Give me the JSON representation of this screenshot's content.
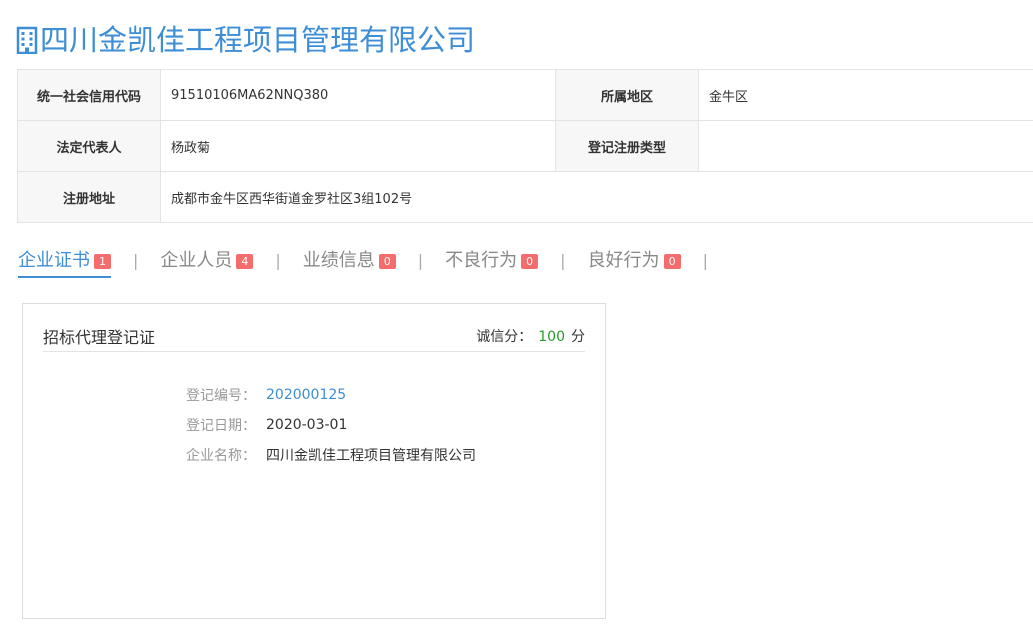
{
  "company": {
    "title": "四川金凯佳工程项目管理有限公司",
    "icon": "building-icon"
  },
  "info": {
    "credit_code_label": "统一社会信用代码",
    "credit_code": "91510106MA62NNQ380",
    "region_label": "所属地区",
    "region": "金牛区",
    "legal_rep_label": "法定代表人",
    "legal_rep": "杨政菊",
    "reg_type_label": "登记注册类型",
    "reg_type": "",
    "address_label": "注册地址",
    "address": "成都市金牛区西华街道金罗社区3组102号"
  },
  "tabs": [
    {
      "label": "企业证书",
      "count": "1",
      "active": true
    },
    {
      "label": "企业人员",
      "count": "4",
      "active": false
    },
    {
      "label": "业绩信息",
      "count": "0",
      "active": false
    },
    {
      "label": "不良行为",
      "count": "0",
      "active": false
    },
    {
      "label": "良好行为",
      "count": "0",
      "active": false
    }
  ],
  "separator": "|",
  "certificate": {
    "title": "招标代理登记证",
    "score_label": "诚信分：",
    "score": "100",
    "score_unit": "分",
    "fields": {
      "number_label": "登记编号：",
      "number": "202000125",
      "date_label": "登记日期：",
      "date": "2020-03-01",
      "name_label": "企业名称：",
      "name": "四川金凯佳工程项目管理有限公司"
    }
  },
  "colors": {
    "accent": "#3e8ed6",
    "badge": "#f56c6c",
    "score": "#2b9a2b"
  }
}
